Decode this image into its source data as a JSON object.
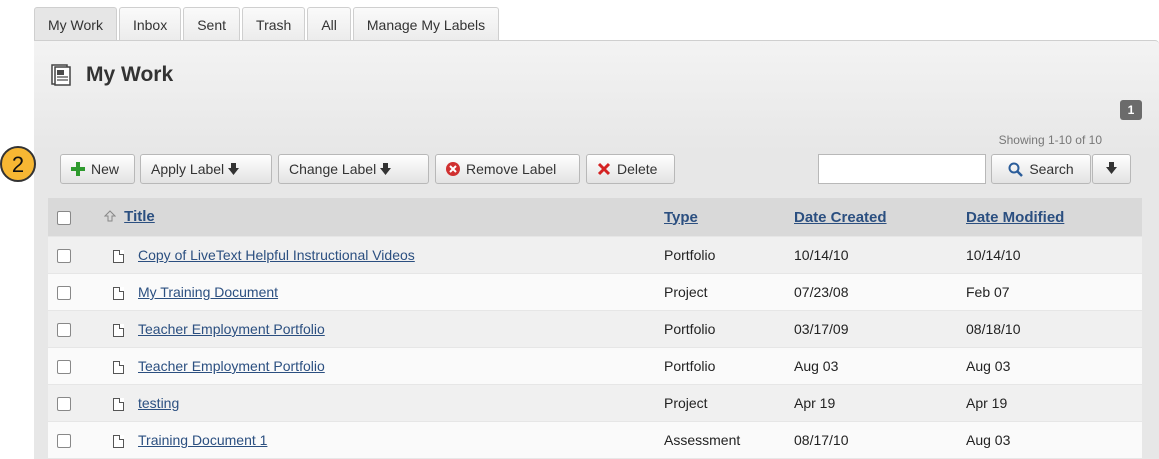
{
  "tabs": [
    "My Work",
    "Inbox",
    "Sent",
    "Trash",
    "All",
    "Manage My Labels"
  ],
  "page_title": "My Work",
  "pagination": {
    "showing": "Showing 1-10 of 10",
    "current_page": "1"
  },
  "step_badge": "2",
  "toolbar": {
    "new": "New",
    "apply_label": "Apply Label",
    "change_label": "Change Label",
    "remove_label": "Remove Label",
    "delete": "Delete",
    "search_value": "",
    "search": "Search"
  },
  "table": {
    "headers": {
      "title": "Title",
      "type": "Type",
      "created": "Date Created",
      "modified": "Date Modified"
    },
    "rows": [
      {
        "title": "Copy of LiveText Helpful Instructional Videos",
        "type": "Portfolio",
        "created": "10/14/10",
        "modified": "10/14/10"
      },
      {
        "title": "My Training Document",
        "type": "Project",
        "created": "07/23/08",
        "modified": "Feb 07"
      },
      {
        "title": "Teacher Employment Portfolio",
        "type": "Portfolio",
        "created": "03/17/09",
        "modified": "08/18/10"
      },
      {
        "title": "Teacher Employment Portfolio",
        "type": "Portfolio",
        "created": "Aug 03",
        "modified": "Aug 03"
      },
      {
        "title": "testing",
        "type": "Project",
        "created": "Apr 19",
        "modified": "Apr 19"
      },
      {
        "title": "Training Document 1",
        "type": "Assessment",
        "created": "08/17/10",
        "modified": "Aug 03"
      }
    ]
  },
  "colors": {
    "link": "#2b4f80",
    "badge": "#f7b733",
    "new_plus": "#2e9a2e",
    "delete_x": "#d42222",
    "remove_circle": "#d03030"
  }
}
